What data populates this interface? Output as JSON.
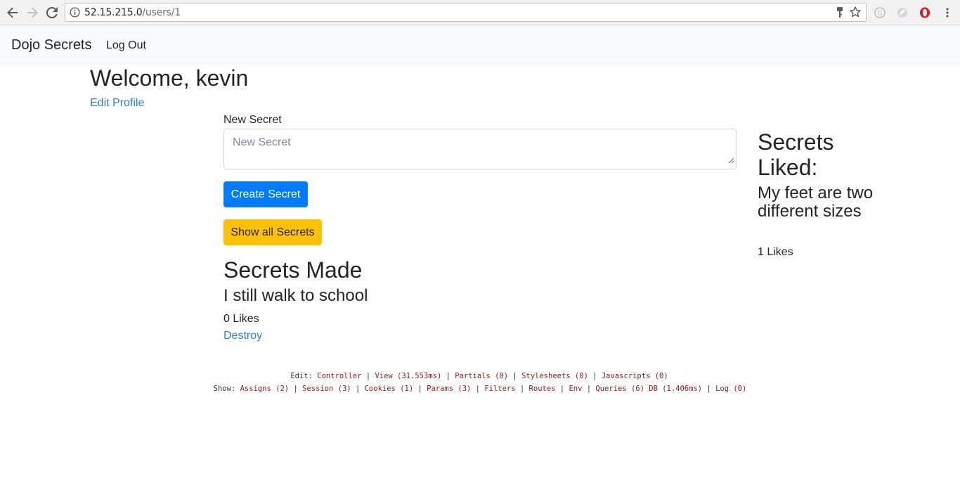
{
  "browser": {
    "url_host": "52.15.215.0",
    "url_path": "/users/1",
    "back_icon": "arrow-left-icon",
    "forward_icon": "arrow-right-icon",
    "reload_icon": "reload-icon"
  },
  "navbar": {
    "brand": "Dojo Secrets",
    "logout": "Log Out"
  },
  "header": {
    "welcome": "Welcome, kevin",
    "edit_profile": "Edit Profile"
  },
  "form": {
    "label": "New Secret",
    "placeholder": "New Secret",
    "value": "",
    "create_button": "Create Secret",
    "show_all_button": "Show all Secrets"
  },
  "secrets_made": {
    "heading": "Secrets Made",
    "items": [
      {
        "text": "I still walk to school",
        "likes": "0 Likes",
        "destroy": "Destroy"
      }
    ]
  },
  "secrets_liked": {
    "heading": "Secrets Liked:",
    "items": [
      {
        "text": "My feet are two different sizes",
        "likes": "1 Likes"
      }
    ]
  },
  "debug_bar": {
    "edit_prefix": "Edit:",
    "edit_links": [
      "Controller",
      "View (31.553ms)",
      "Partials (0)",
      "Stylesheets (0)",
      "Javascripts (0)"
    ],
    "show_prefix": "Show:",
    "show_links": [
      "Assigns (2)",
      "Session (3)",
      "Cookies (1)",
      "Params (3)",
      "Filters",
      "Routes",
      "Env",
      "Queries (6) DB (1.406ms)",
      "Log (0)"
    ]
  },
  "colors": {
    "primary": "#007bff",
    "warning": "#ffc107",
    "link": "#2f7fc8",
    "navbar_bg": "#f8f9fa"
  }
}
